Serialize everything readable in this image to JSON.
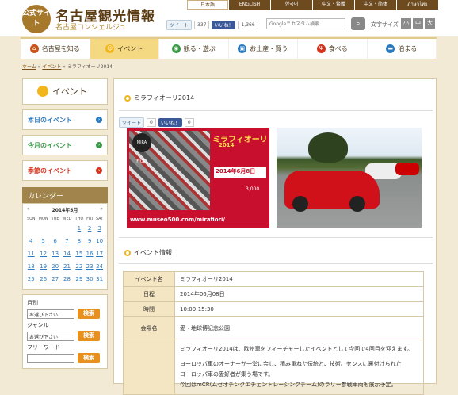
{
  "header": {
    "seal": "公式サイト",
    "title": "名古屋観光情報",
    "subtitle": "名古屋コンシェルジュ",
    "languages": [
      "日本語",
      "ENGLISH",
      "한국어",
      "中文・繁體",
      "中文・简体",
      "ภาษาไทย"
    ],
    "tweet_label": "ツイート",
    "tweet_count": "337",
    "like_label": "いいね！",
    "like_count": "1,366",
    "search_placeholder": "Google™カスタム検索",
    "font_size_label": "文字サイズ",
    "font_sizes": [
      "小",
      "中",
      "大"
    ]
  },
  "nav": [
    {
      "label": "名古屋を知る",
      "icon": "building-icon",
      "color": "#c9541c"
    },
    {
      "label": "イベント",
      "icon": "smile-icon",
      "color": "#f2b51b",
      "active": true
    },
    {
      "label": "観る・遊ぶ",
      "icon": "camera-icon",
      "color": "#3b9a48"
    },
    {
      "label": "お土産・買う",
      "icon": "bag-icon",
      "color": "#2a7ac0"
    },
    {
      "label": "食べる",
      "icon": "fork-icon",
      "color": "#d6331f"
    },
    {
      "label": "泊まる",
      "icon": "bed-icon",
      "color": "#2a7ac0"
    }
  ],
  "breadcrumb": {
    "home": "ホーム",
    "sep": " » ",
    "event": "イベント",
    "current": "ミラフィオーリ2014"
  },
  "sidebar": {
    "title": "イベント",
    "items": [
      {
        "label": "本日のイベント",
        "color": "#2a7ac0"
      },
      {
        "label": "今月のイベント",
        "color": "#3b9a48"
      },
      {
        "label": "季節のイベント",
        "color": "#d6331f"
      }
    ],
    "calendar_title": "カレンダー",
    "calendar_prev": "«",
    "calendar_month": "2014年5月",
    "calendar_next": "»",
    "weekdays": [
      "SUN",
      "MON",
      "TUE",
      "WED",
      "THU",
      "FRI",
      "SAT"
    ],
    "weeks": [
      [
        "",
        "",
        "",
        "",
        "1",
        "2",
        "3"
      ],
      [
        "4",
        "5",
        "6",
        "7",
        "8",
        "9",
        "10"
      ],
      [
        "11",
        "12",
        "13",
        "14",
        "15",
        "16",
        "17"
      ],
      [
        "18",
        "19",
        "20",
        "21",
        "22",
        "23",
        "24"
      ],
      [
        "25",
        "26",
        "27",
        "28",
        "29",
        "30",
        "31"
      ]
    ],
    "month_label": "月別",
    "genre_label": "ジャンル",
    "keyword_label": "フリーワード",
    "select_placeholder": "お選び下さい",
    "search_label": "検索"
  },
  "main": {
    "title": "ミラフィオーリ2014",
    "tweet_label": "ツイート",
    "tweet_count": "0",
    "like_label": "いいね！",
    "like_count": "0",
    "poster": {
      "title": "ミラフィオーリ",
      "year": "2014",
      "date": "2014年6月8日",
      "price_line": "3,000",
      "url": "www.museo500.com/mirafiori/",
      "logo": "MIRA FIORI"
    },
    "info_title": "イベント情報",
    "info_rows": [
      {
        "key": "イベント名",
        "value": "ミラフィオーリ2014"
      },
      {
        "key": "日程",
        "value": "2014年06月08日"
      },
      {
        "key": "時間",
        "value": "10:00-15:30"
      },
      {
        "key": "会場名",
        "value": "愛・地球博記念公園"
      }
    ],
    "desc_lines": [
      "ミラフィオーリ2014は、欧州車をフィーチャーしたイベントとして今回で4回目を迎えます。",
      "ヨーロッパ車のオーナーが一堂に会し、積み重ねた伝統と、技術、センスに裏付けられた",
      "ヨーロッパ車の愛好者が集う場です。",
      "今回はmCR(ムゼオチンクエチェントレーシングチーム)のラリー参戦車両も展示予定。"
    ]
  }
}
